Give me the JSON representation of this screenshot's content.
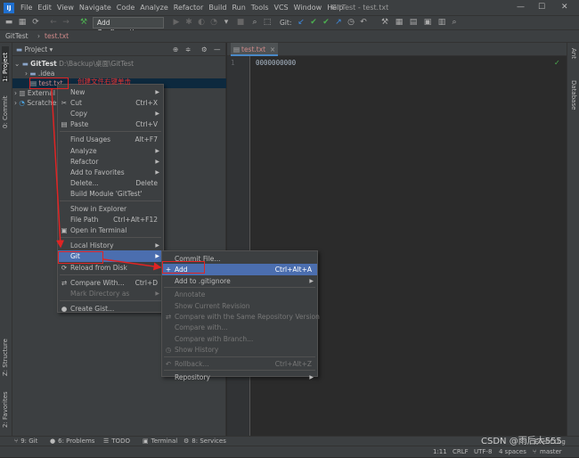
{
  "menubar": {
    "items": [
      "File",
      "Edit",
      "View",
      "Navigate",
      "Code",
      "Analyze",
      "Refactor",
      "Build",
      "Run",
      "Tools",
      "VCS",
      "Window",
      "Help"
    ],
    "window_title": "GitTest - test.txt"
  },
  "toolbar": {
    "add_config_label": "Add Configuration...",
    "git_label": "Git:"
  },
  "navbar": {
    "project": "GitTest",
    "file": "test.txt"
  },
  "left_tabs": {
    "project": "1: Project",
    "commit": "0: Commit",
    "structure": "Z: Structure",
    "favorites": "2: Favorites"
  },
  "right_tabs": {
    "ant": "Ant",
    "database": "Database"
  },
  "project_panel": {
    "title": "Project",
    "root_name": "GitTest",
    "root_path": "D:\\Backup\\桌面\\GitTest",
    "idea": ".idea",
    "file": "test.txt",
    "external": "External Libraries",
    "scratches": "Scratches and Consoles"
  },
  "annotation": "创建文件右键单击",
  "editor": {
    "tab": "test.txt",
    "line_number": "1",
    "content": "0000000000"
  },
  "context_menu": [
    {
      "label": "New",
      "shortcut": "",
      "submenu": true
    },
    {
      "label": "Cut",
      "shortcut": "Ctrl+X",
      "icon": "✂"
    },
    {
      "label": "Copy",
      "shortcut": "",
      "submenu": true
    },
    {
      "label": "Paste",
      "shortcut": "Ctrl+V",
      "icon": "▤"
    },
    {
      "sep": true
    },
    {
      "label": "Find Usages",
      "shortcut": "Alt+F7"
    },
    {
      "label": "Analyze",
      "shortcut": "",
      "submenu": true
    },
    {
      "label": "Refactor",
      "shortcut": "",
      "submenu": true
    },
    {
      "label": "Add to Favorites",
      "shortcut": "",
      "submenu": true
    },
    {
      "label": "Delete...",
      "shortcut": "Delete"
    },
    {
      "label": "Build Module 'GitTest'",
      "shortcut": ""
    },
    {
      "sep": true
    },
    {
      "label": "Show in Explorer",
      "shortcut": ""
    },
    {
      "label": "File Path",
      "shortcut": "Ctrl+Alt+F12"
    },
    {
      "label": "Open in Terminal",
      "shortcut": "",
      "icon": "▣"
    },
    {
      "sep": true
    },
    {
      "label": "Local History",
      "shortcut": "",
      "submenu": true
    },
    {
      "label": "Git",
      "shortcut": "",
      "submenu": true,
      "selected": true
    },
    {
      "label": "Reload from Disk",
      "shortcut": "",
      "icon": "⟳"
    },
    {
      "sep": true
    },
    {
      "label": "Compare With...",
      "shortcut": "Ctrl+D",
      "icon": "⇄"
    },
    {
      "label": "Mark Directory as",
      "shortcut": "",
      "submenu": true,
      "disabled": true
    },
    {
      "sep": true
    },
    {
      "label": "Create Gist...",
      "shortcut": "",
      "icon": "●"
    }
  ],
  "git_submenu": [
    {
      "label": "Commit File...",
      "shortcut": ""
    },
    {
      "label": "Add",
      "shortcut": "Ctrl+Alt+A",
      "selected": true,
      "icon": "+"
    },
    {
      "label": "Add to .gitignore",
      "shortcut": "",
      "submenu": true
    },
    {
      "sep": true
    },
    {
      "label": "Annotate",
      "shortcut": "",
      "disabled": true
    },
    {
      "label": "Show Current Revision",
      "shortcut": "",
      "disabled": true
    },
    {
      "label": "Compare with the Same Repository Version",
      "shortcut": "",
      "disabled": true,
      "icon": "⇄"
    },
    {
      "label": "Compare with...",
      "shortcut": "",
      "disabled": true
    },
    {
      "label": "Compare with Branch...",
      "shortcut": "",
      "disabled": true
    },
    {
      "label": "Show History",
      "shortcut": "",
      "disabled": true,
      "icon": "◷"
    },
    {
      "sep": true
    },
    {
      "label": "Rollback...",
      "shortcut": "Ctrl+Alt+Z",
      "disabled": true,
      "icon": "↶"
    },
    {
      "sep": true
    },
    {
      "label": "Repository",
      "shortcut": "",
      "submenu": true
    }
  ],
  "bottom_tabs": [
    {
      "label": "9: Git",
      "icon": "⑂"
    },
    {
      "label": "6: Problems",
      "icon": "●"
    },
    {
      "label": "TODO",
      "icon": "☰"
    },
    {
      "label": "Terminal",
      "icon": "▣"
    },
    {
      "label": "8: Services",
      "icon": "⚙"
    }
  ],
  "status": {
    "position": "1:11",
    "line_sep": "CRLF",
    "encoding": "UTF-8",
    "indent": "4 spaces",
    "branch": "master",
    "event_log": "Event Log",
    "watermark": "CSDN @雨后大555"
  }
}
